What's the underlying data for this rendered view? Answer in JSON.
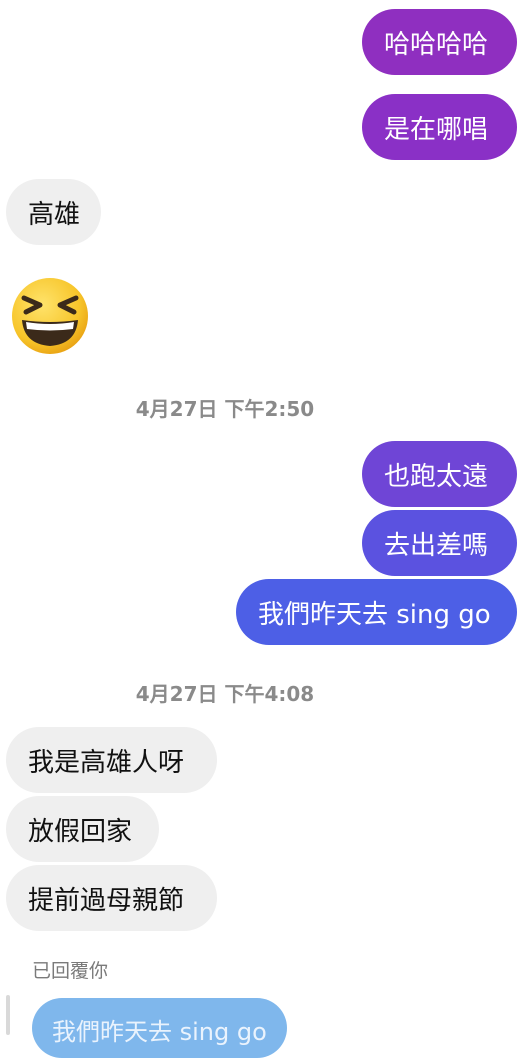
{
  "messages": {
    "m1": "哈哈哈哈",
    "m2": "是在哪唱",
    "m3": "高雄",
    "m4_emoji": "grinning-squinting-face",
    "timestamp1": "4月27日 下午2:50",
    "m5": "也跑太遠",
    "m6": "去出差嗎",
    "m7": "我們昨天去 sing go",
    "timestamp2": "4月27日 下午4:08",
    "m8": "我是高雄人呀",
    "m9": "放假回家",
    "m10": "提前過母親節"
  },
  "reply": {
    "label": "已回覆你",
    "quoted_text": "我們昨天去 sing go"
  },
  "colors": {
    "out_purple": "#8f2fc0",
    "out_violet": "#6f45d6",
    "out_indigo": "#5b52e0",
    "out_blue": "#4d5fe6",
    "in_bg": "#efefef",
    "reply_bg": "#7fb7ec"
  }
}
